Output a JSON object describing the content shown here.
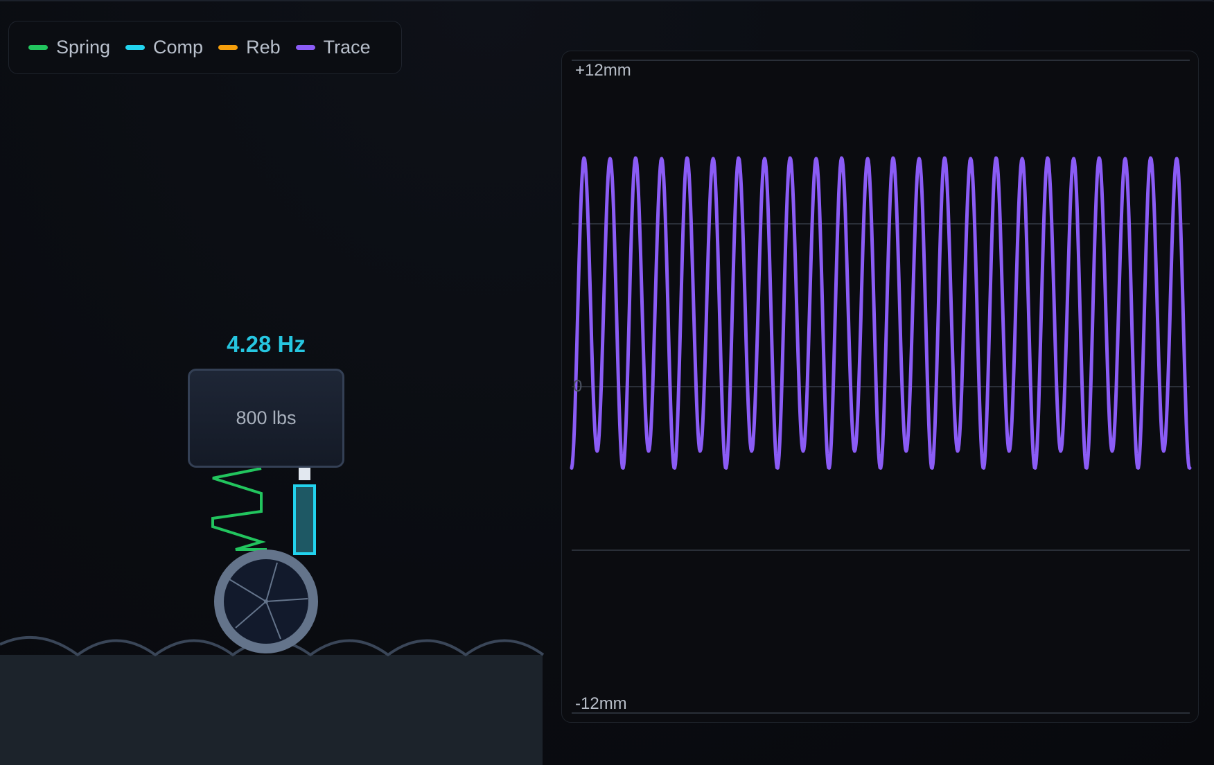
{
  "legend": [
    {
      "label": "Spring",
      "color": "#22c55e"
    },
    {
      "label": "Comp",
      "color": "#22d3ee"
    },
    {
      "label": "Reb",
      "color": "#f59e0b"
    },
    {
      "label": "Trace",
      "color": "#8b5cf6"
    }
  ],
  "sim": {
    "frequency": "4.28 Hz",
    "mass_label": "800 lbs",
    "spring_color": "#22c55e",
    "damper_color": "#22d3ee",
    "wheel_color": "#64748b",
    "road_color": "#1c232b"
  },
  "trace": {
    "top_label": "+12mm",
    "zero_label": "0",
    "bottom_label": "-12mm",
    "line_color": "#8b5cf6",
    "range_mm": [
      -12,
      12
    ]
  }
}
